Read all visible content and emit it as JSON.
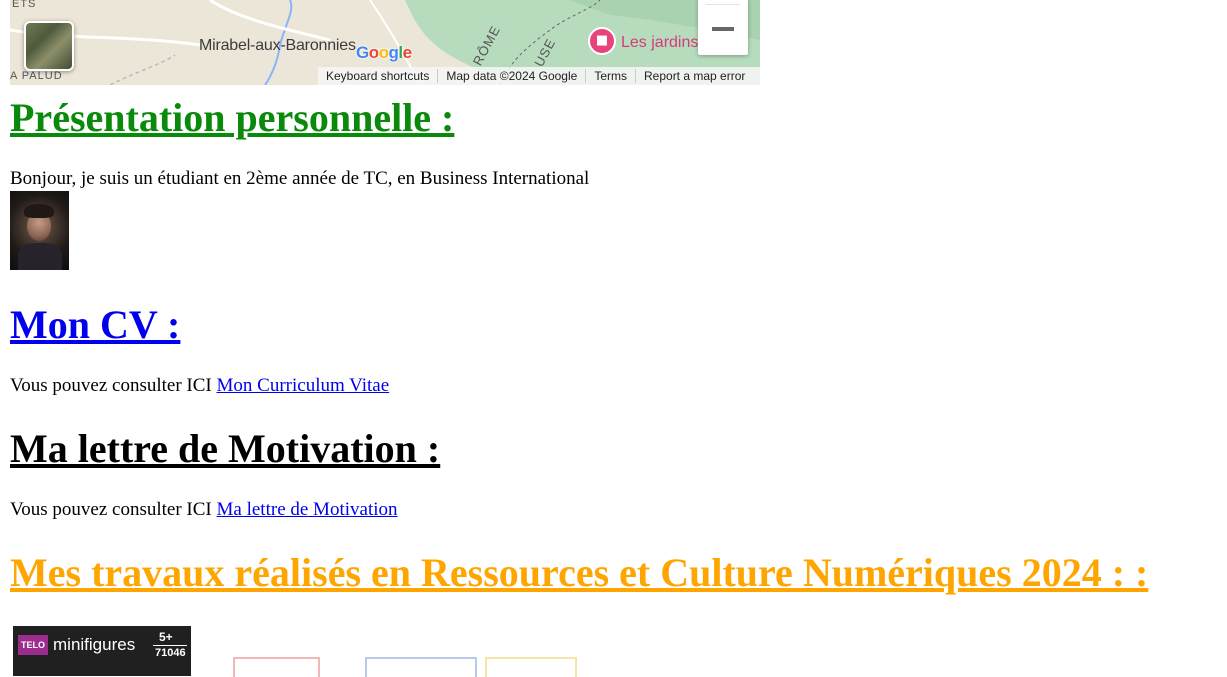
{
  "map": {
    "town_label": "Mirabel-aux-Baronnies",
    "edge_label_top": "ETS",
    "edge_label_bottom": "A PALUD",
    "road_label_1": "RÔME",
    "road_label_2": "USE",
    "logo_text": "Google",
    "poi_label": "Les jardins",
    "poi_icon": "hotel-bed-icon",
    "attribution": {
      "keyboard": "Keyboard shortcuts",
      "data": "Map data ©2024 Google",
      "terms": "Terms",
      "report": "Report a map error"
    },
    "colors": {
      "land": "#ece6d8",
      "forest": "#b7dbbd",
      "poi": "#e8437d"
    }
  },
  "presentation": {
    "heading": "Présentation personnelle :",
    "text": "Bonjour, je suis un étudiant en 2ème année de TC, en Business International",
    "heading_color": "#0a8a0a"
  },
  "cv": {
    "heading": "Mon CV :",
    "text": "Vous pouvez consulter ICI",
    "link": "Mon Curriculum Vitae",
    "heading_color": "#0000ee"
  },
  "lettre": {
    "heading": "Ma lettre de Motivation :",
    "text": "Vous pouvez consulter ICI",
    "link": "Ma lettre de Motivation"
  },
  "travaux": {
    "heading": "Mes travaux réalisés en Ressources et Culture Numériques 2024 : :",
    "heading_color": "#ffa500",
    "lego": {
      "badge": "TELO",
      "title": "minifigures",
      "age": "5+",
      "number": "71046"
    }
  }
}
